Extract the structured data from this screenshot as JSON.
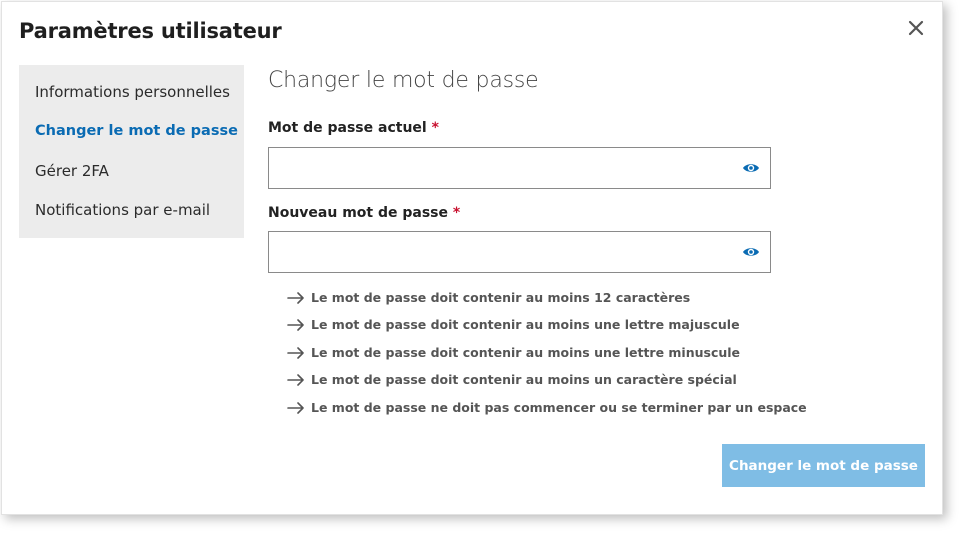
{
  "dialog": {
    "title": "Paramètres utilisateur",
    "close_icon": "close-icon"
  },
  "sidebar": {
    "items": [
      {
        "label": "Informations personnelles",
        "active": false
      },
      {
        "label": "Changer le mot de passe",
        "active": true
      },
      {
        "label": "Gérer 2FA",
        "active": false
      },
      {
        "label": "Notifications par e-mail",
        "active": false
      }
    ]
  },
  "main": {
    "section_title": "Changer le mot de passe",
    "current_password": {
      "label": "Mot de passe actuel",
      "required_mark": "*",
      "value": "",
      "placeholder": "",
      "icon": "eye-icon"
    },
    "new_password": {
      "label": "Nouveau mot de passe",
      "required_mark": "*",
      "value": "",
      "placeholder": "",
      "icon": "eye-icon"
    },
    "rules": [
      "Le mot de passe doit contenir au moins 12 caractères",
      "Le mot de passe doit contenir au moins une lettre majuscule",
      "Le mot de passe doit contenir au moins une lettre minuscule",
      "Le mot de passe doit contenir au moins un caractère spécial",
      "Le mot de passe ne doit pas commencer ou se terminer par un espace"
    ],
    "submit_label": "Changer le mot de passe"
  },
  "colors": {
    "accent": "#0a6bb3",
    "button_disabled": "#7fbde5",
    "required": "#c8102e",
    "sidebar_bg": "#ececec"
  }
}
